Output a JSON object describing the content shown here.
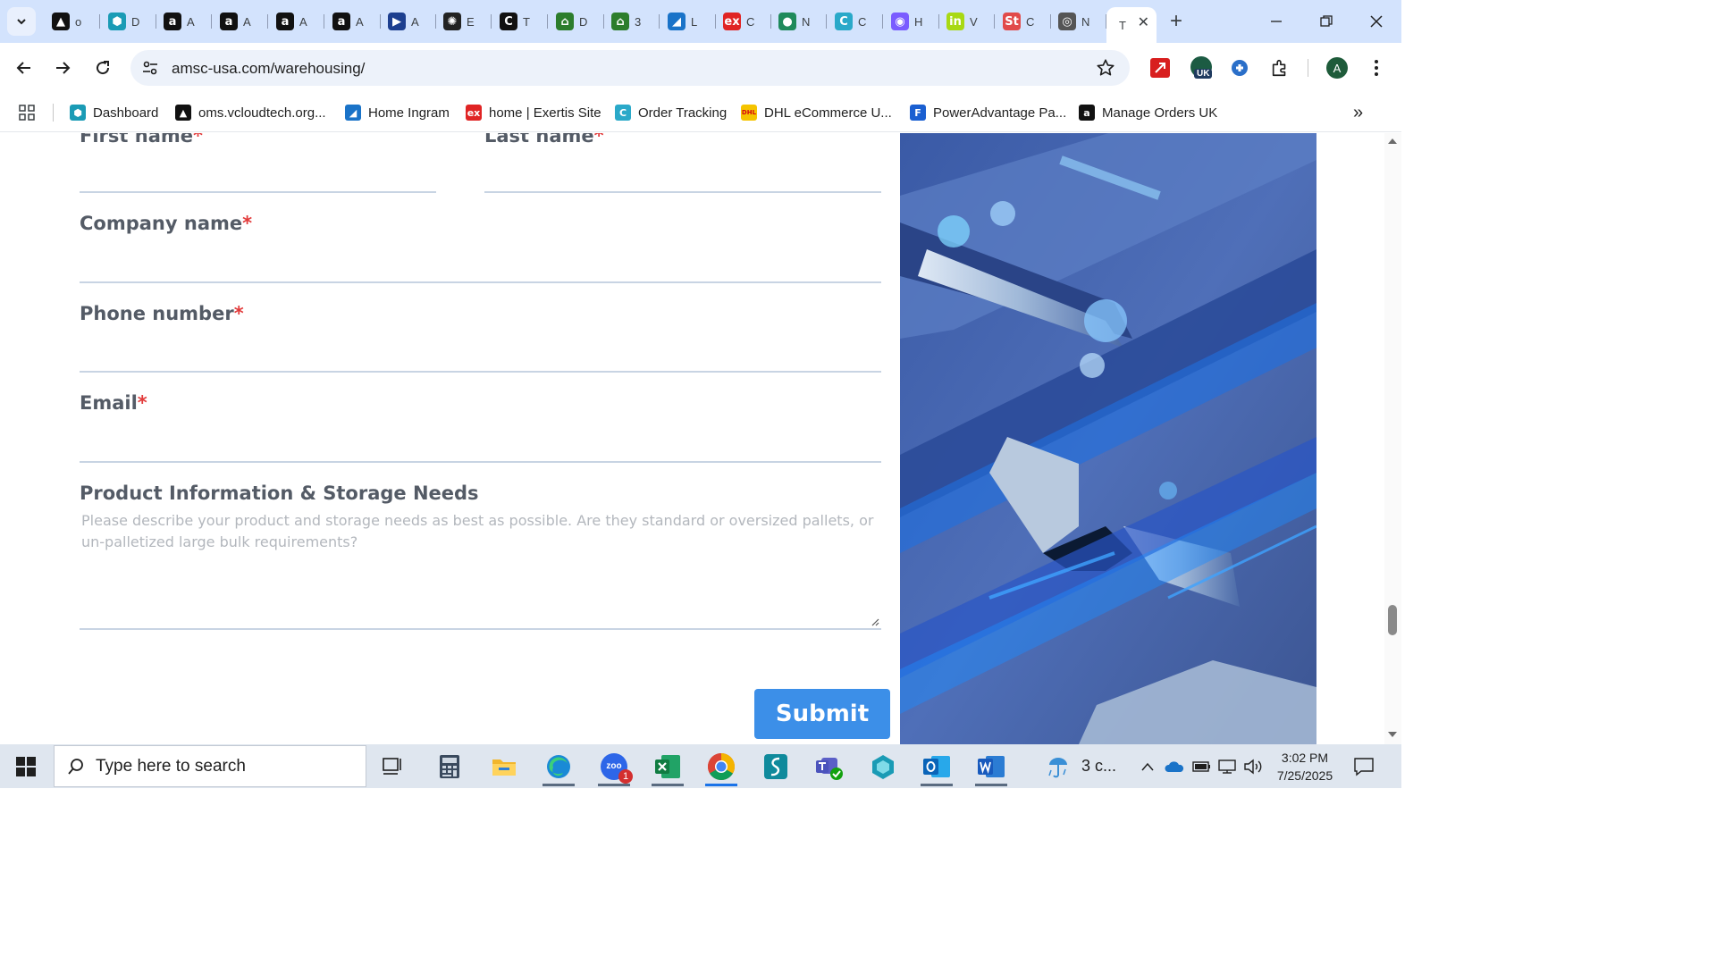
{
  "tabs": [
    {
      "title": "o",
      "icon": "vercel-icon",
      "color": "#111111",
      "glyph": "▲"
    },
    {
      "title": "D",
      "icon": "hexagon-icon",
      "color": "#1a9bb5",
      "glyph": "⬢"
    },
    {
      "title": "A",
      "icon": "amazon-icon",
      "color": "#111111",
      "glyph": "a"
    },
    {
      "title": "A",
      "icon": "amazon-icon",
      "color": "#111111",
      "glyph": "a"
    },
    {
      "title": "A",
      "icon": "amazon-icon",
      "color": "#111111",
      "glyph": "a"
    },
    {
      "title": "A",
      "icon": "amazon-icon",
      "color": "#111111",
      "glyph": "a"
    },
    {
      "title": "A",
      "icon": "arrow-play-icon",
      "color": "#1d3f8f",
      "glyph": "▶"
    },
    {
      "title": "E",
      "icon": "openai-icon",
      "color": "#222222",
      "glyph": "✺"
    },
    {
      "title": "T",
      "icon": "c-logo-icon",
      "color": "#111111",
      "glyph": "C"
    },
    {
      "title": "D",
      "icon": "green-house-icon",
      "color": "#2c7d2c",
      "glyph": "⌂"
    },
    {
      "title": "3",
      "icon": "green-house-icon",
      "color": "#2c7d2c",
      "glyph": "⌂"
    },
    {
      "title": "L",
      "icon": "ingram-icon",
      "color": "#1a73c8",
      "glyph": "◢"
    },
    {
      "title": "C",
      "icon": "exertis-icon",
      "color": "#e02424",
      "glyph": "ex"
    },
    {
      "title": "N",
      "icon": "green-circle-icon",
      "color": "#1f8a5b",
      "glyph": "●"
    },
    {
      "title": "C",
      "icon": "c-swirl-icon",
      "color": "#2aa9c9",
      "glyph": "C"
    },
    {
      "title": "H",
      "icon": "copilot-icon",
      "color": "#7a5cff",
      "glyph": "◉"
    },
    {
      "title": "V",
      "icon": "infos-icon",
      "color": "#a8d914",
      "glyph": "in"
    },
    {
      "title": "C",
      "icon": "stores-icon",
      "color": "#e14a4a",
      "glyph": "St"
    },
    {
      "title": "N",
      "icon": "gray-logo-icon",
      "color": "#555555",
      "glyph": "◎"
    }
  ],
  "active_tab": {
    "title": "T"
  },
  "address_bar": {
    "url": "amsc-usa.com/warehousing/"
  },
  "bookmarks": [
    {
      "label": "Dashboard",
      "icon": "hexagon-icon",
      "color": "#1a9bb5",
      "glyph": "⬢"
    },
    {
      "label": "oms.vcloudtech.org...",
      "icon": "vercel-icon",
      "color": "#111111",
      "glyph": "▲"
    },
    {
      "label": "Home Ingram",
      "icon": "ingram-icon",
      "color": "#1a73c8",
      "glyph": "◢"
    },
    {
      "label": "home | Exertis Site",
      "icon": "exertis-icon",
      "color": "#e02424",
      "glyph": "ex"
    },
    {
      "label": "Order Tracking",
      "icon": "c-swirl-icon",
      "color": "#2aa9c9",
      "glyph": "C"
    },
    {
      "label": "DHL eCommerce U...",
      "icon": "dhl-icon",
      "color": "#f5c400",
      "glyph": "DHL"
    },
    {
      "label": "PowerAdvantage Pa...",
      "icon": "poweradvantage-icon",
      "color": "#1a5fd1",
      "glyph": "F"
    },
    {
      "label": "Manage Orders UK",
      "icon": "amazon-icon",
      "color": "#111111",
      "glyph": "a"
    }
  ],
  "form": {
    "first_name_label": "First name",
    "last_name_label": "Last name",
    "company_label": "Company name",
    "phone_label": "Phone number",
    "email_label": "Email",
    "required_mark": "*",
    "product_label": "Product Information & Storage Needs",
    "product_placeholder": "Please describe your product and storage needs as best as possible. Are they standard or oversized pallets, or un-palletized large bulk requirements?",
    "submit_label": "Submit"
  },
  "taskbar": {
    "search_placeholder": "Type here to search",
    "weather": "3 c...",
    "time": "3:02 PM",
    "date": "7/25/2025",
    "zoom_badge": "1"
  },
  "ext_uk_badge": "UK",
  "profile_initial": "A",
  "colors": {
    "accent_blue": "#3c8fe8",
    "required_red": "#e23b3b",
    "tabstrip": "#d3e3fd"
  }
}
